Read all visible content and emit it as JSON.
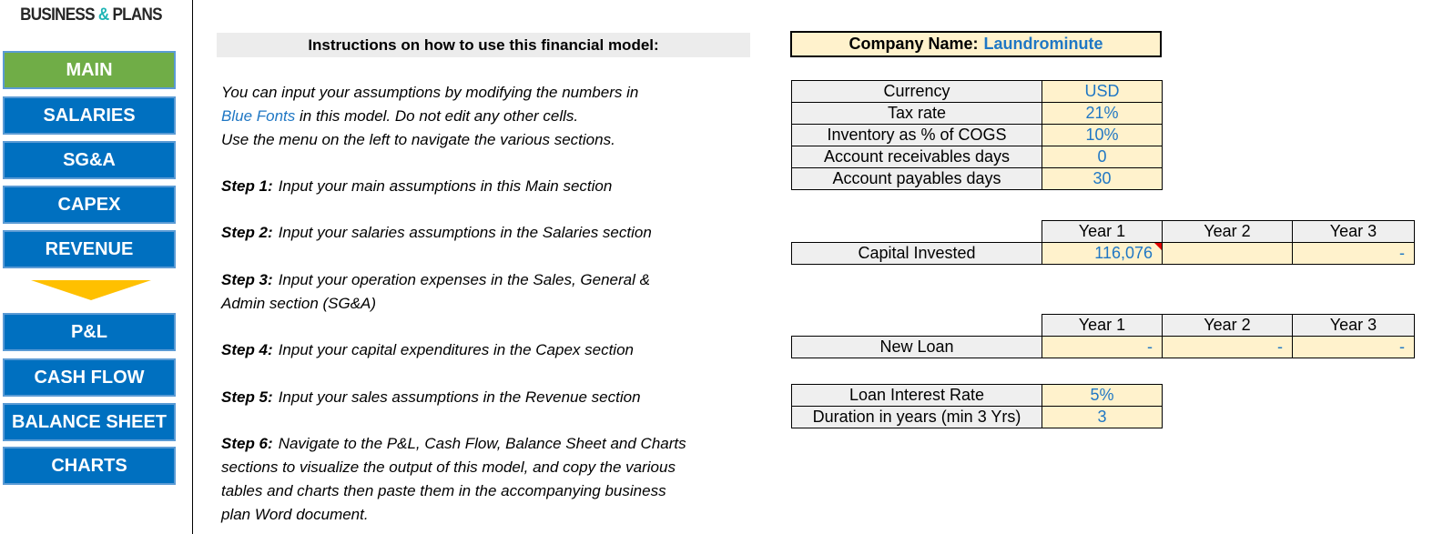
{
  "sidebar": {
    "logo": {
      "part1": "BUSINESS ",
      "amp": "&",
      "part2": " PLANS"
    },
    "items": [
      {
        "label": "MAIN",
        "active": true
      },
      {
        "label": "SALARIES"
      },
      {
        "label": "SG&A"
      },
      {
        "label": "CAPEX"
      },
      {
        "label": "REVENUE"
      },
      {
        "label": "P&L"
      },
      {
        "label": "CASH FLOW"
      },
      {
        "label": "BALANCE SHEET"
      },
      {
        "label": "CHARTS"
      }
    ],
    "divider_icon": "down-arrow"
  },
  "instructions": {
    "title": "Instructions on how to use this financial model:",
    "intro_line1": "You can input your assumptions by modifying the numbers in",
    "intro_blue": "Blue Fonts",
    "intro_line2_rest": " in this model. Do not edit any other cells.",
    "intro_line3": "Use the menu on the left to navigate the various sections.",
    "steps": [
      {
        "label": "Step 1:",
        "lines": [
          "Input your main assumptions in this Main section"
        ]
      },
      {
        "label": "Step 2:",
        "lines": [
          "Input your salaries assumptions in the Salaries section"
        ]
      },
      {
        "label": "Step 3:",
        "lines": [
          "Input your operation expenses in the Sales, General &",
          "Admin section (SG&A)"
        ]
      },
      {
        "label": "Step 4:",
        "lines": [
          "Input your capital expenditures in the Capex section"
        ]
      },
      {
        "label": "Step 5:",
        "lines": [
          "Input your sales assumptions in the Revenue section"
        ]
      },
      {
        "label": "Step 6:",
        "lines": [
          "Navigate to the P&L, Cash Flow, Balance Sheet and Charts",
          "sections to visualize the output of this model, and copy the various",
          "tables and charts then paste them in the accompanying business",
          "plan Word document."
        ]
      }
    ]
  },
  "company": {
    "label": "Company Name:",
    "value": "Laundrominute"
  },
  "assumptions": [
    {
      "label": "Currency",
      "value": "USD"
    },
    {
      "label": "Tax rate",
      "value": "21%"
    },
    {
      "label": "Inventory as % of COGS",
      "value": "10%"
    },
    {
      "label": "Account receivables days",
      "value": "0"
    },
    {
      "label": "Account payables days",
      "value": "30"
    }
  ],
  "capital": {
    "headers": [
      "Year 1",
      "Year 2",
      "Year 3"
    ],
    "label": "Capital Invested",
    "values": [
      "116,076",
      "",
      "-"
    ]
  },
  "loan": {
    "headers": [
      "Year 1",
      "Year 2",
      "Year 3"
    ],
    "label": "New Loan",
    "values": [
      "-",
      "-",
      "-"
    ]
  },
  "loan_terms": [
    {
      "label": "Loan Interest Rate",
      "value": "5%"
    },
    {
      "label": "Duration in years (min 3 Yrs)",
      "value": "3"
    }
  ],
  "colors": {
    "nav_blue": "#0070c0",
    "nav_active": "#70ad47",
    "input_fill": "#fff2cc",
    "input_font": "#1f77c4",
    "arrow": "#ffc000"
  }
}
